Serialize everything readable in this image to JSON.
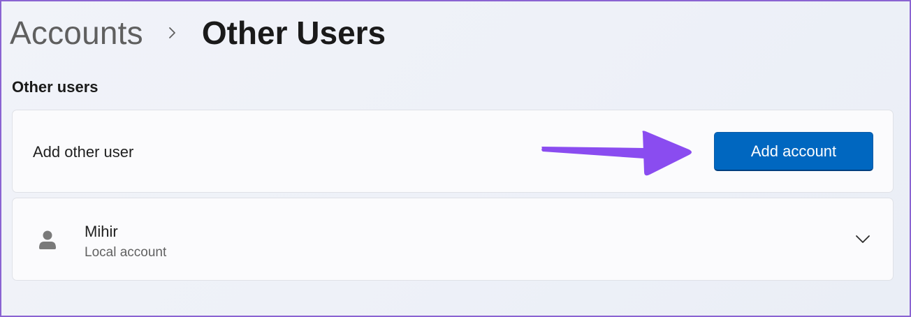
{
  "breadcrumb": {
    "parent": "Accounts",
    "separator_icon": "chevron-right-icon",
    "current": "Other Users"
  },
  "section": {
    "title": "Other users"
  },
  "add_user_card": {
    "label": "Add other user",
    "button_label": "Add account"
  },
  "annotation": {
    "arrow_color": "#8a4cf0"
  },
  "user_card": {
    "avatar_icon": "person-icon",
    "name": "Mihir",
    "account_type": "Local account",
    "expand_icon": "chevron-down-icon"
  },
  "colors": {
    "accent": "#0067c0",
    "frame_border": "#8a63d2",
    "background": "#eef1f8"
  }
}
